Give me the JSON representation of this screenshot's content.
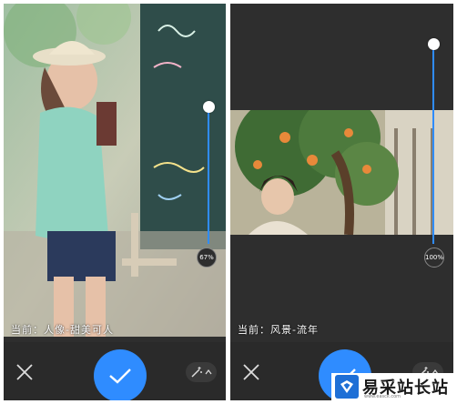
{
  "left_screen": {
    "filter_caption": "当前：人像-甜美可人",
    "intensity": "67%",
    "intensity_fraction": 0.67,
    "photo_subject": "girl-in-straw-hat-photo"
  },
  "right_screen": {
    "filter_caption": "当前：风景-流年",
    "intensity": "100%",
    "intensity_fraction": 1.0,
    "photo_subject": "boy-under-orange-tree-photo"
  },
  "toolbar": {
    "cancel_icon": "close-icon",
    "confirm_icon": "check-icon",
    "magic_icon": "magic-wand-icon",
    "expand_icon": "chevron-up-icon"
  },
  "watermark": {
    "text": "易采站长站",
    "sub": "www.easck.com"
  },
  "colors": {
    "accent": "#2f8cff",
    "background": "#2e2e2e",
    "bar": "#2a2a2a"
  }
}
